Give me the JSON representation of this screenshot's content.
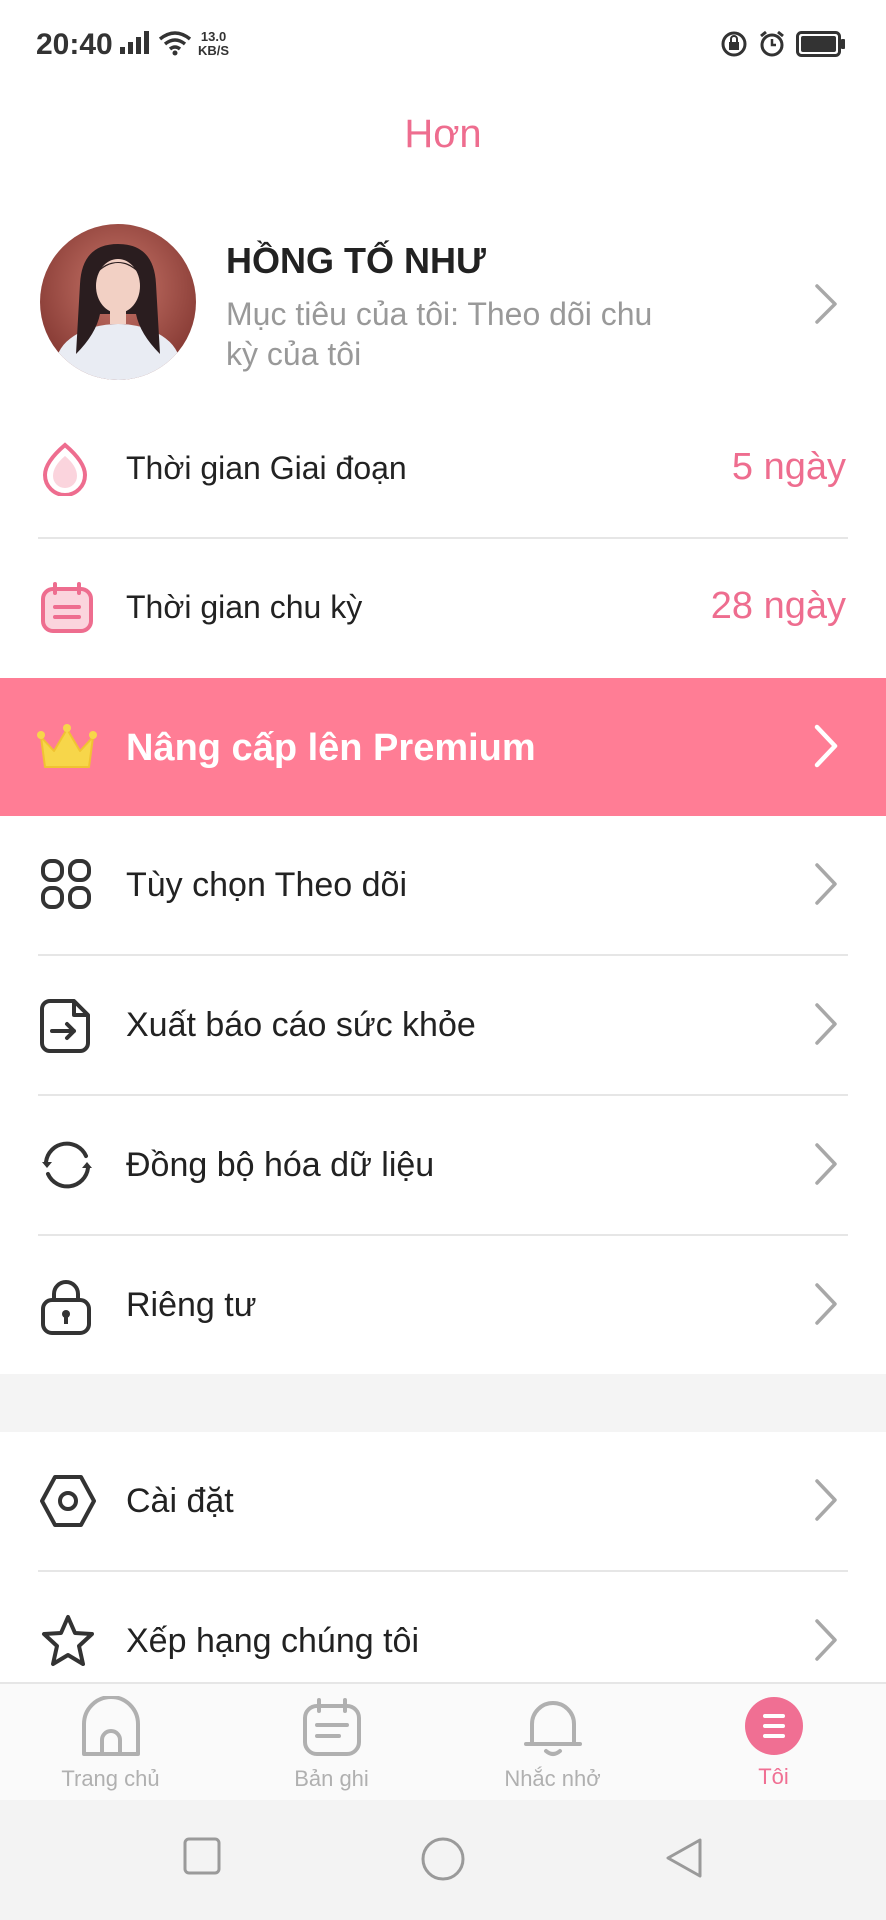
{
  "status_bar": {
    "time": "20:40",
    "speed_value": "13.0",
    "speed_unit": "KB/S"
  },
  "page": {
    "title": "Hơn"
  },
  "profile": {
    "name": "HỒNG TỐ NHƯ",
    "goal": "Mục tiêu của tôi: Theo dõi chu kỳ của tôi"
  },
  "stats": [
    {
      "label": "Thời gian Giai đoạn",
      "value": "5 ngày"
    },
    {
      "label": "Thời gian chu kỳ",
      "value": "28 ngày"
    }
  ],
  "premium": {
    "label": "Nâng cấp lên Premium"
  },
  "menu": [
    {
      "label": "Tùy chọn Theo dõi",
      "icon": "grid-icon"
    },
    {
      "label": "Xuất báo cáo sức khỏe",
      "icon": "export-report-icon"
    },
    {
      "label": "Đồng bộ hóa dữ liệu",
      "icon": "sync-icon"
    },
    {
      "label": "Riêng tư",
      "icon": "lock-icon"
    },
    {
      "label": "Cài đặt",
      "icon": "settings-icon"
    },
    {
      "label": "Xếp hạng chúng tôi",
      "icon": "star-icon"
    }
  ],
  "bottom_nav": [
    {
      "label": "Trang chủ",
      "icon": "home-icon",
      "active": false
    },
    {
      "label": "Bản ghi",
      "icon": "calendar-icon",
      "active": false
    },
    {
      "label": "Nhắc nhở",
      "icon": "bell-icon",
      "active": false
    },
    {
      "label": "Tôi",
      "icon": "menu-icon",
      "active": true
    }
  ],
  "colors": {
    "accent": "#ee6d8f",
    "premium_bg": "#ff7d95",
    "crown": "#f7d64a"
  }
}
